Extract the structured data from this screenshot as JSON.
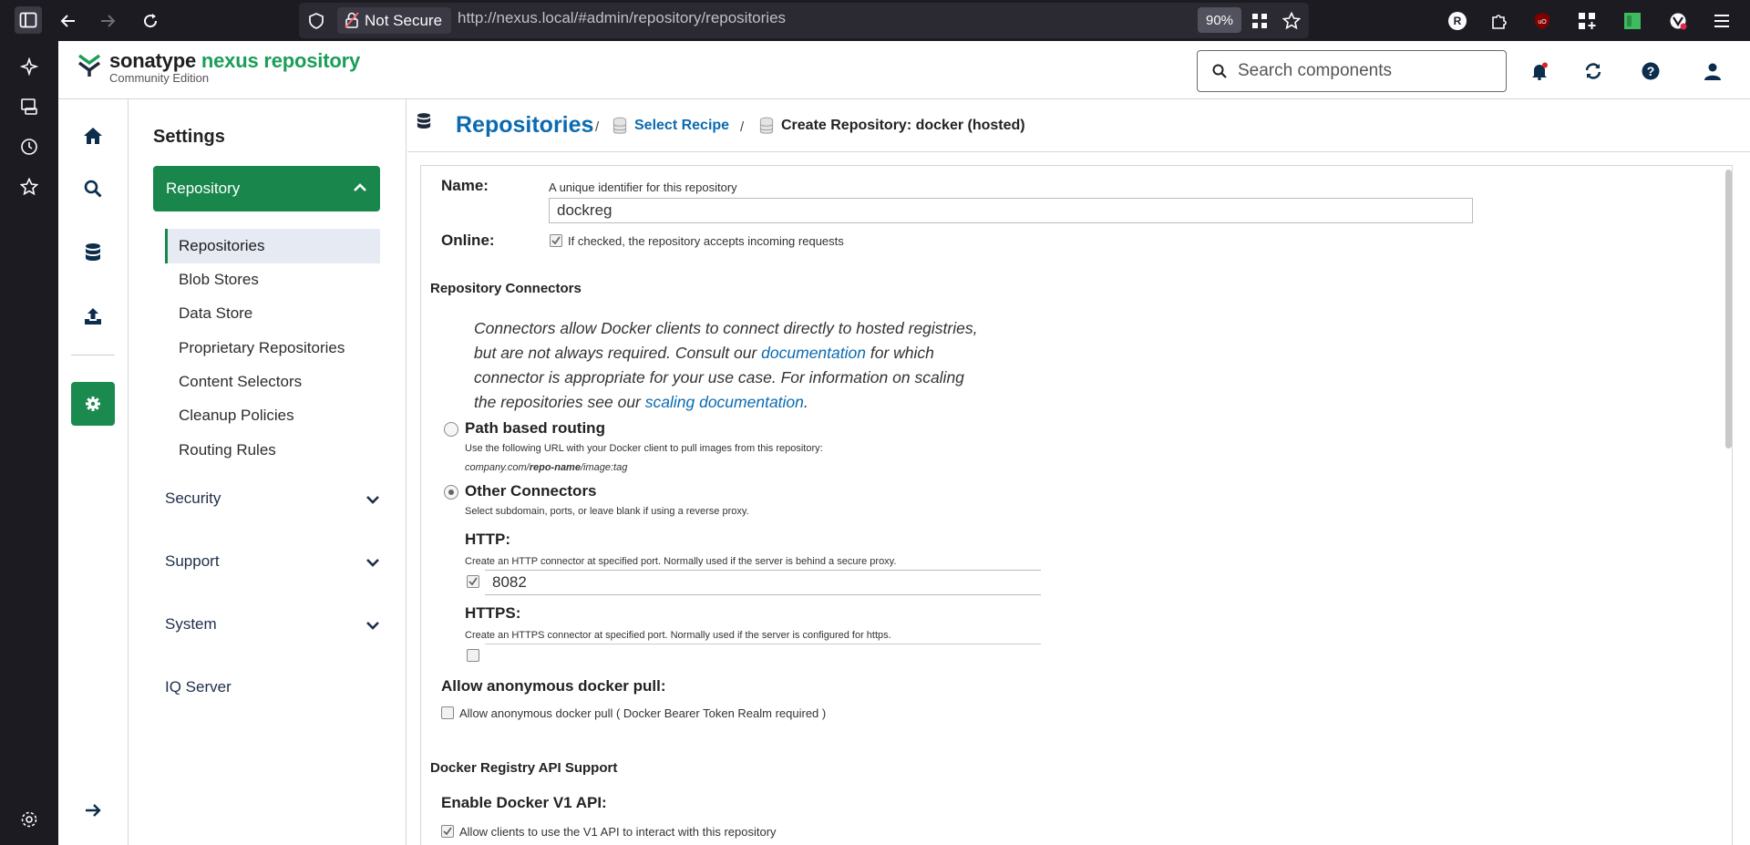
{
  "browser": {
    "not_secure": "Not Secure",
    "url_host": "http://nexus.local/",
    "url_path": "#admin/repository/repositories",
    "zoom": "90%",
    "profile_badge": "R"
  },
  "header": {
    "brand_a": "sonatype ",
    "brand_b": "nexus repository",
    "edition": "Community Edition",
    "search_placeholder": "Search components"
  },
  "settings": {
    "title": "Settings",
    "repository_label": "Repository",
    "items": [
      {
        "label": "Repositories"
      },
      {
        "label": "Blob Stores"
      },
      {
        "label": "Data Store"
      },
      {
        "label": "Proprietary Repositories"
      },
      {
        "label": "Content Selectors"
      },
      {
        "label": "Cleanup Policies"
      },
      {
        "label": "Routing Rules"
      }
    ],
    "groups": [
      {
        "label": "Security"
      },
      {
        "label": "Support"
      },
      {
        "label": "System"
      },
      {
        "label": "IQ Server"
      }
    ]
  },
  "breadcrumb": {
    "title": "Repositories",
    "sep": "/",
    "recipe": "Select Recipe",
    "create": "Create Repository: docker (hosted)"
  },
  "form": {
    "name_label": "Name:",
    "name_help": "A unique identifier for this repository",
    "name_value": "dockreg",
    "online_label": "Online:",
    "online_help": "If checked, the repository accepts incoming requests",
    "connectors_title": "Repository Connectors",
    "connectors_p1": "Connectors allow Docker clients to connect directly to hosted registries, but are not always required. Consult our ",
    "connectors_link1": "documentation",
    "connectors_p2": " for which connector is appropriate for your use case. For information on scaling the repositories see our ",
    "connectors_link2": "scaling documentation",
    "connectors_p3": ".",
    "path_routing": "Path based routing",
    "path_help": "Use the following URL with your Docker client to pull images from this repository:",
    "path_example_a": "company.com/",
    "path_example_b": "repo-name",
    "path_example_c": "/image:tag",
    "other_connectors": "Other Connectors",
    "other_help": "Select subdomain, ports, or leave blank if using a reverse proxy.",
    "http_label": "HTTP:",
    "http_help": "Create an HTTP connector at specified port. Normally used if the server is behind a secure proxy.",
    "http_value": "8082",
    "https_label": "HTTPS:",
    "https_help": "Create an HTTPS connector at specified port. Normally used if the server is configured for https.",
    "anon_label": "Allow anonymous docker pull:",
    "anon_help": "Allow anonymous docker pull ( Docker Bearer Token Realm required )",
    "api_title": "Docker Registry API Support",
    "v1_label": "Enable Docker V1 API:",
    "v1_help": "Allow clients to use the V1 API to interact with this repository"
  }
}
